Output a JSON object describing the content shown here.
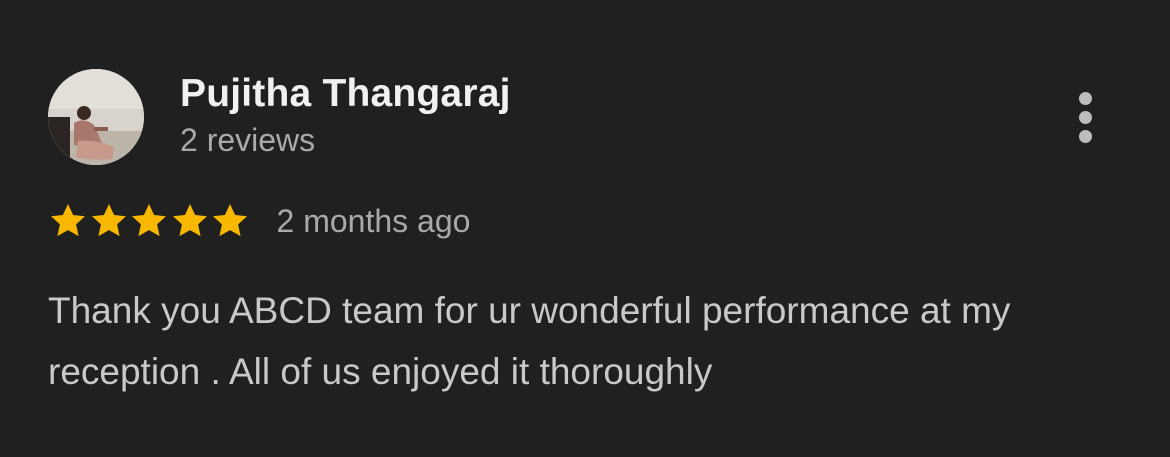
{
  "review": {
    "reviewer": {
      "name": "Pujitha Thangaraj",
      "review_count_text": "2 reviews",
      "avatar_icon": "user-photo"
    },
    "rating": {
      "stars": 5,
      "max_stars": 5,
      "star_color": "#f9b800"
    },
    "time_ago": "2 months ago",
    "text": "Thank you ABCD team for ur wonderful performance at my reception . All of us enjoyed it thoroughly",
    "menu_icon": "more-vert-icon"
  },
  "colors": {
    "background": "#202020",
    "name": "#f1f1f1",
    "secondary_text": "#a9a9a9",
    "body_text": "#c9c9c9"
  }
}
